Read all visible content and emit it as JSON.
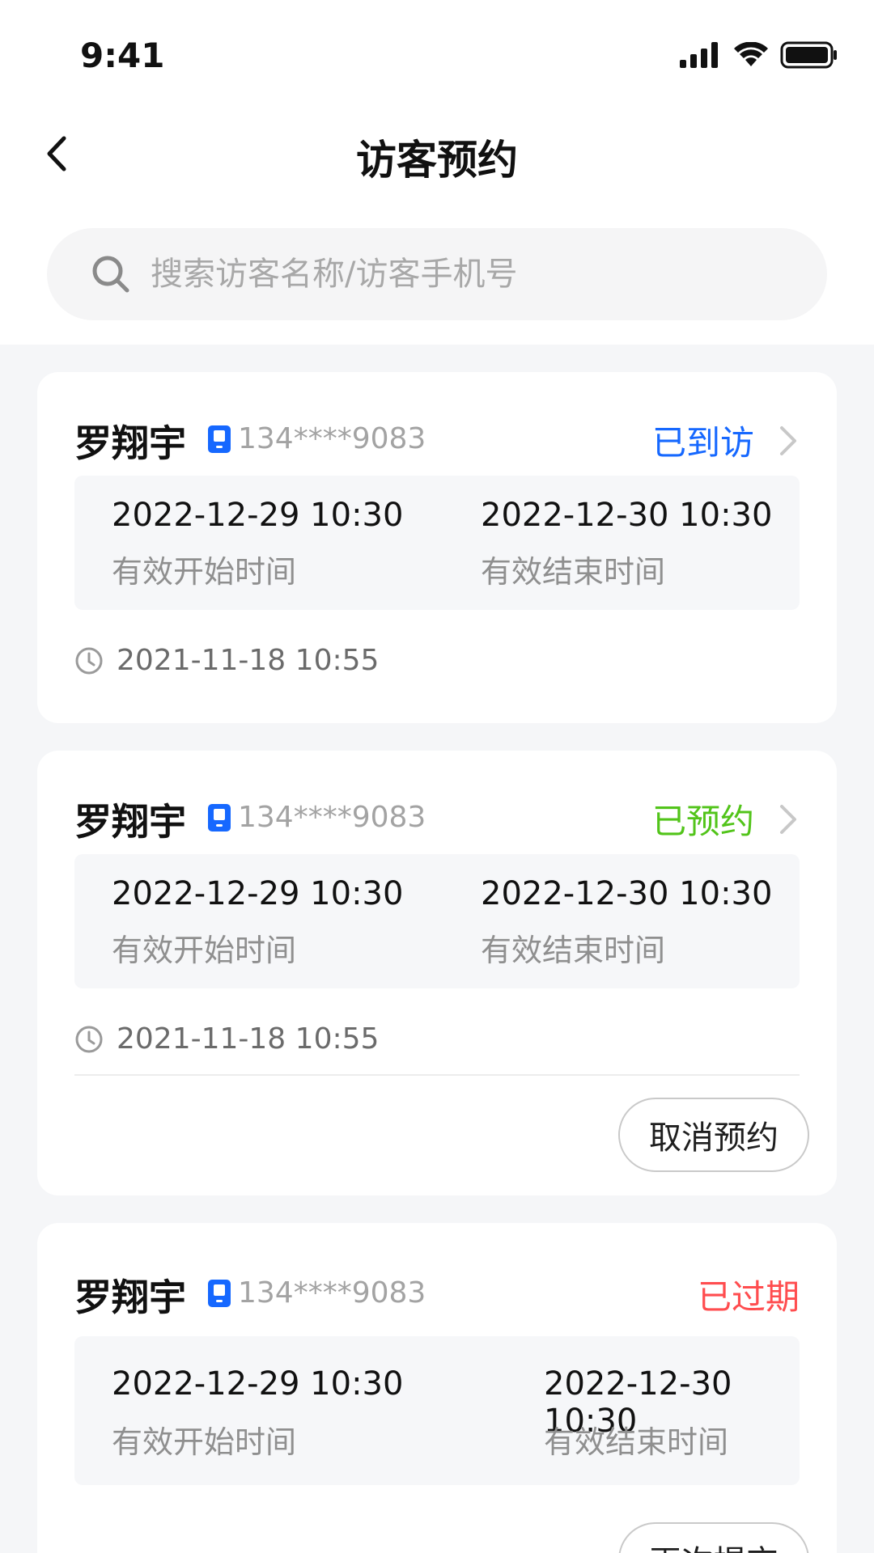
{
  "status_bar": {
    "time": "9:41"
  },
  "nav": {
    "title": "访客预约"
  },
  "search": {
    "placeholder": "搜索访客名称/访客手机号"
  },
  "colors": {
    "visited": "#1668ff",
    "reserved": "#52c41a",
    "expired": "#ff4d4f",
    "phone_icon": "#1668ff"
  },
  "cards": [
    {
      "name": "罗翔宇",
      "phone": "134****9083",
      "status": "已到访",
      "start_time": "2022-12-29 10:30",
      "start_label": "有效开始时间",
      "end_time": "2022-12-30 10:30",
      "end_label": "有效结束时间",
      "created_at": "2021-11-18 10:55"
    },
    {
      "name": "罗翔宇",
      "phone": "134****9083",
      "status": "已预约",
      "start_time": "2022-12-29 10:30",
      "start_label": "有效开始时间",
      "end_time": "2022-12-30 10:30",
      "end_label": "有效结束时间",
      "created_at": "2021-11-18 10:55",
      "action": "取消预约"
    },
    {
      "name": "罗翔宇",
      "phone": "134****9083",
      "status": "已过期",
      "start_time": "2022-12-29 10:30",
      "start_label": "有效开始时间",
      "end_time": "2022-12-30 10:30",
      "end_label": "有效结束时间",
      "action": "再次提交"
    }
  ]
}
